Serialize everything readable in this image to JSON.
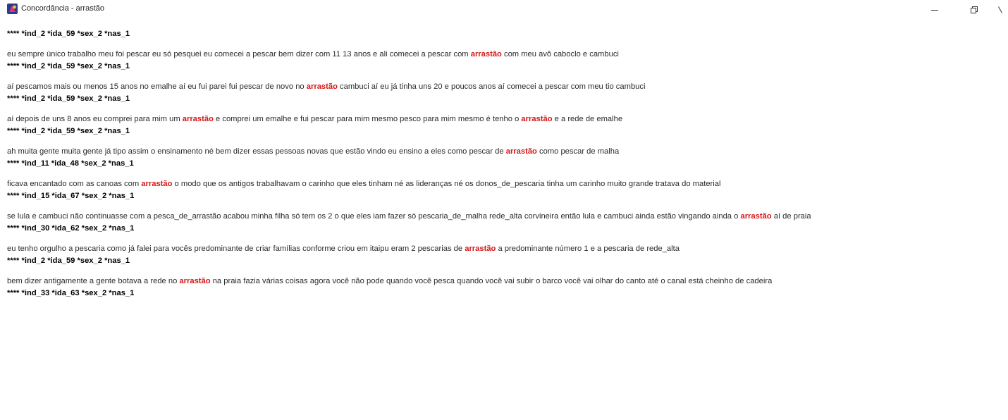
{
  "window": {
    "title": "Concordância - arrastão",
    "minimize_icon": "minimize-icon",
    "maximize_icon": "restore-icon",
    "close_icon": "close-icon"
  },
  "colors": {
    "keyword": "#d41717",
    "text": "#2a2a2a",
    "header": "#000000"
  },
  "concordance": {
    "keyword": "arrastão",
    "initial_header": "**** *ind_2 *ida_59 *sex_2 *nas_1",
    "entries": [
      {
        "pre": "eu sempre único trabalho meu foi pescar eu só pesquei eu comecei a pescar bem dizer com 11 13 anos e ali comecei a pescar com ",
        "kw": "arrastão",
        "post": " com meu avô caboclo e cambuci",
        "next_header": "**** *ind_2 *ida_59 *sex_2 *nas_1"
      },
      {
        "pre": "aí pescamos mais ou menos 15 anos no emalhe aí eu fui parei fui pescar de novo no ",
        "kw": "arrastão",
        "post": " cambuci aí eu já tinha uns 20 e poucos anos aí comecei a pescar com meu tio cambuci",
        "next_header": "**** *ind_2 *ida_59 *sex_2 *nas_1"
      },
      {
        "pre": "aí depois de uns 8 anos eu comprei para mim um ",
        "kw": "arrastão",
        "mid": " e comprei um emalhe e fui pescar para mim mesmo pesco para mim mesmo é tenho o ",
        "kw2": "arrastão",
        "post": " e a rede de emalhe",
        "next_header": "**** *ind_2 *ida_59 *sex_2 *nas_1"
      },
      {
        "pre": "ah muita gente muita gente já tipo assim o ensinamento né bem dizer essas pessoas novas que estão vindo eu ensino a eles como pescar de ",
        "kw": "arrastão",
        "post": " como pescar de malha",
        "next_header": "**** *ind_11 *ida_48 *sex_2 *nas_1"
      },
      {
        "pre": "ficava encantado com as canoas com ",
        "kw": "arrastão",
        "post": " o modo que os antigos trabalhavam o carinho que eles tinham né as lideranças né os donos_de_pescaria tinha um carinho muito grande tratava do material",
        "next_header": "**** *ind_15 *ida_67 *sex_2 *nas_1"
      },
      {
        "pre": "se lula e cambuci não continuasse com a pesca_de_arrastão acabou minha filha só tem os 2 o que eles iam fazer só pescaria_de_malha rede_alta corvineira então lula e cambuci ainda estão vingando ainda o ",
        "kw": "arrastão",
        "post": " aí de praia",
        "next_header": "**** *ind_30 *ida_62 *sex_2 *nas_1"
      },
      {
        "pre": "eu tenho orgulho a pescaria como já falei para vocês predominante de criar famílias conforme criou em itaipu eram 2 pescarias de ",
        "kw": "arrastão",
        "post": " a predominante número 1 e a pescaria de rede_alta",
        "next_header": "**** *ind_2 *ida_59 *sex_2 *nas_1"
      },
      {
        "pre": "bem dizer antigamente a gente botava a rede no ",
        "kw": "arrastão",
        "post": " na praia fazia várias coisas agora você não pode quando você pesca quando você vai subir o barco você vai olhar do canto até o canal está cheinho de cadeira",
        "next_header": "**** *ind_33 *ida_63 *sex_2 *nas_1"
      }
    ]
  }
}
